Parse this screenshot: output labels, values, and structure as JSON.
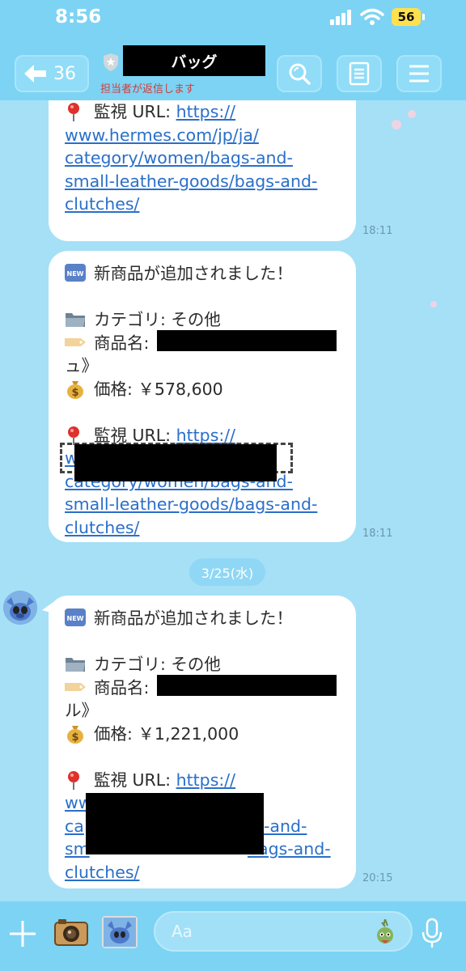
{
  "status_bar": {
    "time": "8:56",
    "battery": "56"
  },
  "header": {
    "back_count": "36",
    "title": "バッグ",
    "subtitle": "担当者が返信します"
  },
  "messages": [
    {
      "lines": [
        "📍 監視 URL: https://",
        "www.hermes.com/jp/ja/",
        "category/women/bags-and-",
        "small-leather-goods/bags-and-",
        "clutches/"
      ],
      "url_label": "監視 URL: ",
      "url_lines": [
        "https://",
        "www.hermes.com/jp/ja/",
        "category/women/bags-and-",
        "small-leather-goods/bags-and-",
        "clutches/"
      ],
      "time": "18:11"
    },
    {
      "headline": "新商品が追加されました！",
      "category": "カテゴリ: その他",
      "product_label": "商品名:",
      "product_tail": "ュ》",
      "price": "価格: ￥578,600",
      "url_label": "監視 URL: ",
      "url_lines": [
        "https://",
        "w",
        "category/women/bags-and-",
        "small-leather-goods/bags-and-",
        "clutches/"
      ],
      "time": "18:11"
    },
    {
      "headline": "新商品が追加されました！",
      "category": "カテゴリ: その他",
      "product_label": "商品名:",
      "product_tail": "ル》",
      "price": "価格: ￥1,221,000",
      "url_label": "監視 URL: ",
      "url_lines": [
        "https://",
        "ww",
        "ca",
        "sm",
        "clutches/"
      ],
      "url_right": [
        "-and-",
        "bags-and-"
      ],
      "time": "20:15"
    }
  ],
  "date_chip": "3/25(水)",
  "input": {
    "placeholder": "Aa"
  },
  "icons": {
    "back": "arrow-left-icon",
    "search": "search-icon",
    "notes": "notes-icon",
    "menu": "menu-icon",
    "pin": "pin-icon",
    "new": "new-badge-icon",
    "folder": "folder-icon",
    "tag": "tag-icon",
    "money": "money-bag-icon"
  }
}
